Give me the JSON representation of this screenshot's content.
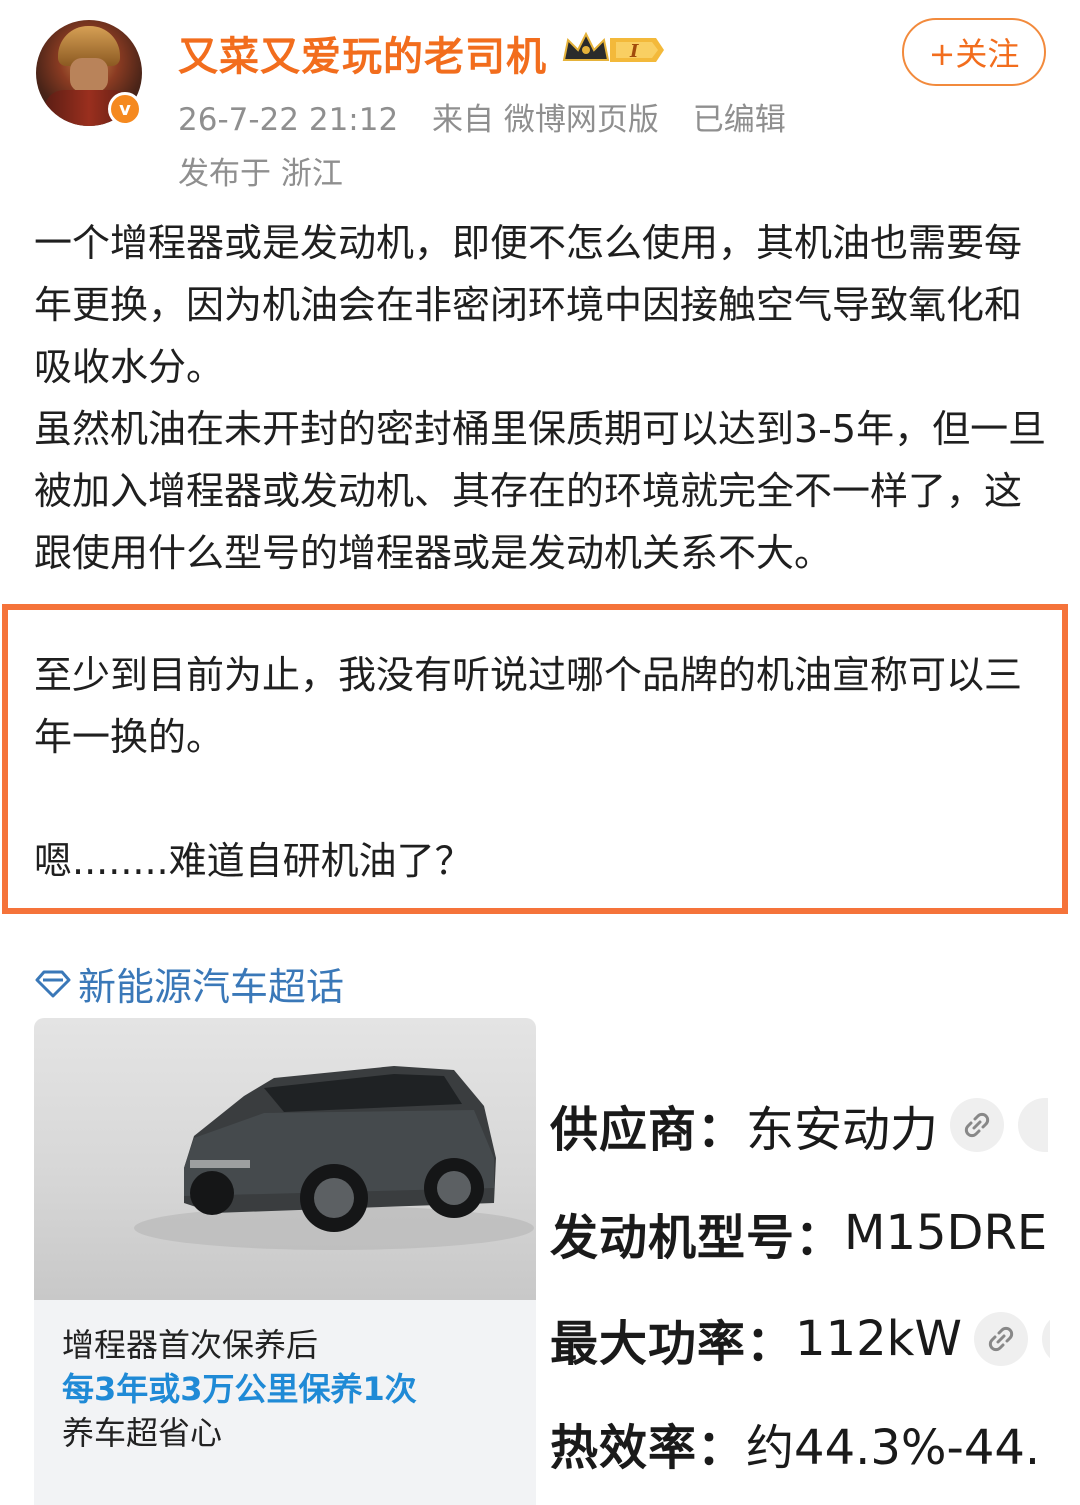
{
  "user": {
    "name": "又菜又爱玩的老司机",
    "level_badge": "I",
    "timestamp": "26-7-22 21:12",
    "source": "来自 微博网页版",
    "edited": "已编辑",
    "location": "发布于 浙江",
    "follow_label": "+关注"
  },
  "post": {
    "paragraphs": [
      "一个增程器或是发动机，即便不怎么使用，其机油也需要每年更换，因为机油会在非密闭环境中因接触空气导致氧化和吸收水分。",
      "虽然机油在未开封的密封桶里保质期可以达到3-5年，但一旦被加入增程器或发动机、其存在的环境就完全不一样了，这跟使用什么型号的增程器或是发动机关系不大。"
    ],
    "highlight": {
      "line1": "至少到目前为止，我没有听说过哪个品牌的机油宣称可以三年一换的。",
      "line2": "嗯........难道自研机油了？"
    },
    "topic": "新能源汽车超话"
  },
  "image": {
    "caption1": "增程器首次保养后",
    "caption2": "每3年或3万公里保养1次",
    "caption3": "养车超省心",
    "specs": [
      {
        "key": "供应商",
        "value": "东安动力"
      },
      {
        "key": "发动机型号",
        "value": "M15DRE"
      },
      {
        "key": "最大功率",
        "value": "112kW"
      },
      {
        "key": "热效率",
        "value": "约44.3%-44."
      }
    ]
  },
  "colors": {
    "username": "#f26d1d",
    "highlight_border": "#f5733a",
    "topic": "#3a78b8",
    "caption_accent": "#1f8ad6"
  }
}
